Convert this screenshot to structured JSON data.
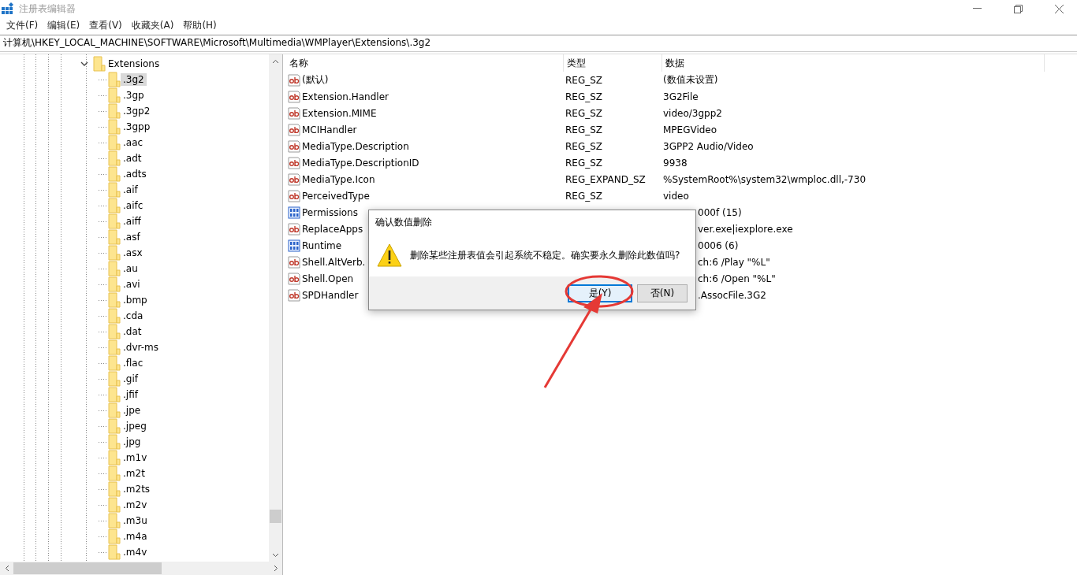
{
  "window": {
    "title": "注册表编辑器"
  },
  "menu": [
    {
      "label": "文件(F)"
    },
    {
      "label": "编辑(E)"
    },
    {
      "label": "查看(V)"
    },
    {
      "label": "收藏夹(A)"
    },
    {
      "label": "帮助(H)"
    }
  ],
  "address": "计算机\\HKEY_LOCAL_MACHINE\\SOFTWARE\\Microsoft\\Multimedia\\WMPlayer\\Extensions\\.3g2",
  "tree": {
    "parent": {
      "label": "Extensions",
      "expanded": true
    },
    "children": [
      {
        "label": ".3g2",
        "selected": true
      },
      {
        "label": ".3gp",
        "selected": false
      },
      {
        "label": ".3gp2",
        "selected": false
      },
      {
        "label": ".3gpp",
        "selected": false
      },
      {
        "label": ".aac",
        "selected": false
      },
      {
        "label": ".adt",
        "selected": false
      },
      {
        "label": ".adts",
        "selected": false
      },
      {
        "label": ".aif",
        "selected": false
      },
      {
        "label": ".aifc",
        "selected": false
      },
      {
        "label": ".aiff",
        "selected": false
      },
      {
        "label": ".asf",
        "selected": false
      },
      {
        "label": ".asx",
        "selected": false
      },
      {
        "label": ".au",
        "selected": false
      },
      {
        "label": ".avi",
        "selected": false
      },
      {
        "label": ".bmp",
        "selected": false
      },
      {
        "label": ".cda",
        "selected": false
      },
      {
        "label": ".dat",
        "selected": false
      },
      {
        "label": ".dvr-ms",
        "selected": false
      },
      {
        "label": ".flac",
        "selected": false
      },
      {
        "label": ".gif",
        "selected": false
      },
      {
        "label": ".jfif",
        "selected": false
      },
      {
        "label": ".jpe",
        "selected": false
      },
      {
        "label": ".jpeg",
        "selected": false
      },
      {
        "label": ".jpg",
        "selected": false
      },
      {
        "label": ".m1v",
        "selected": false
      },
      {
        "label": ".m2t",
        "selected": false
      },
      {
        "label": ".m2ts",
        "selected": false
      },
      {
        "label": ".m2v",
        "selected": false
      },
      {
        "label": ".m3u",
        "selected": false
      },
      {
        "label": ".m4a",
        "selected": false
      },
      {
        "label": ".m4v",
        "selected": false
      }
    ]
  },
  "table": {
    "columns": [
      "名称",
      "类型",
      "数据"
    ],
    "rows": [
      {
        "kind": "string",
        "name": "(默认)",
        "type": "REG_SZ",
        "data": "(数值未设置)"
      },
      {
        "kind": "string",
        "name": "Extension.Handler",
        "type": "REG_SZ",
        "data": "3G2File"
      },
      {
        "kind": "string",
        "name": "Extension.MIME",
        "type": "REG_SZ",
        "data": "video/3gpp2"
      },
      {
        "kind": "string",
        "name": "MCIHandler",
        "type": "REG_SZ",
        "data": "MPEGVideo"
      },
      {
        "kind": "string",
        "name": "MediaType.Description",
        "type": "REG_SZ",
        "data": "3GPP2 Audio/Video"
      },
      {
        "kind": "string",
        "name": "MediaType.DescriptionID",
        "type": "REG_SZ",
        "data": "9938"
      },
      {
        "kind": "string",
        "name": "MediaType.Icon",
        "type": "REG_EXPAND_SZ",
        "data": "%SystemRoot%\\system32\\wmploc.dll,-730"
      },
      {
        "kind": "string",
        "name": "PerceivedType",
        "type": "REG_SZ",
        "data": "video"
      },
      {
        "kind": "binary",
        "name": "Permissions",
        "data_tail": "000f (15)"
      },
      {
        "kind": "string",
        "name": "ReplaceApps",
        "data_tail": "ver.exe|iexplore.exe"
      },
      {
        "kind": "binary",
        "name": "Runtime",
        "data_tail": "0006 (6)"
      },
      {
        "kind": "string",
        "name": "Shell.AltVerb.",
        "data_tail": "ch:6 /Play \"%L\""
      },
      {
        "kind": "string",
        "name": "Shell.Open",
        "data_tail": "ch:6 /Open \"%L\""
      },
      {
        "kind": "string",
        "name": "SPDHandler",
        "data_tail": ".AssocFile.3G2"
      }
    ]
  },
  "dialog": {
    "title": "确认数值删除",
    "message": "删除某些注册表值会引起系统不稳定。确实要永久删除此数值吗?",
    "buttons": [
      {
        "label": "是(Y)",
        "selected": true
      },
      {
        "label": "否(N)",
        "selected": false
      }
    ]
  }
}
